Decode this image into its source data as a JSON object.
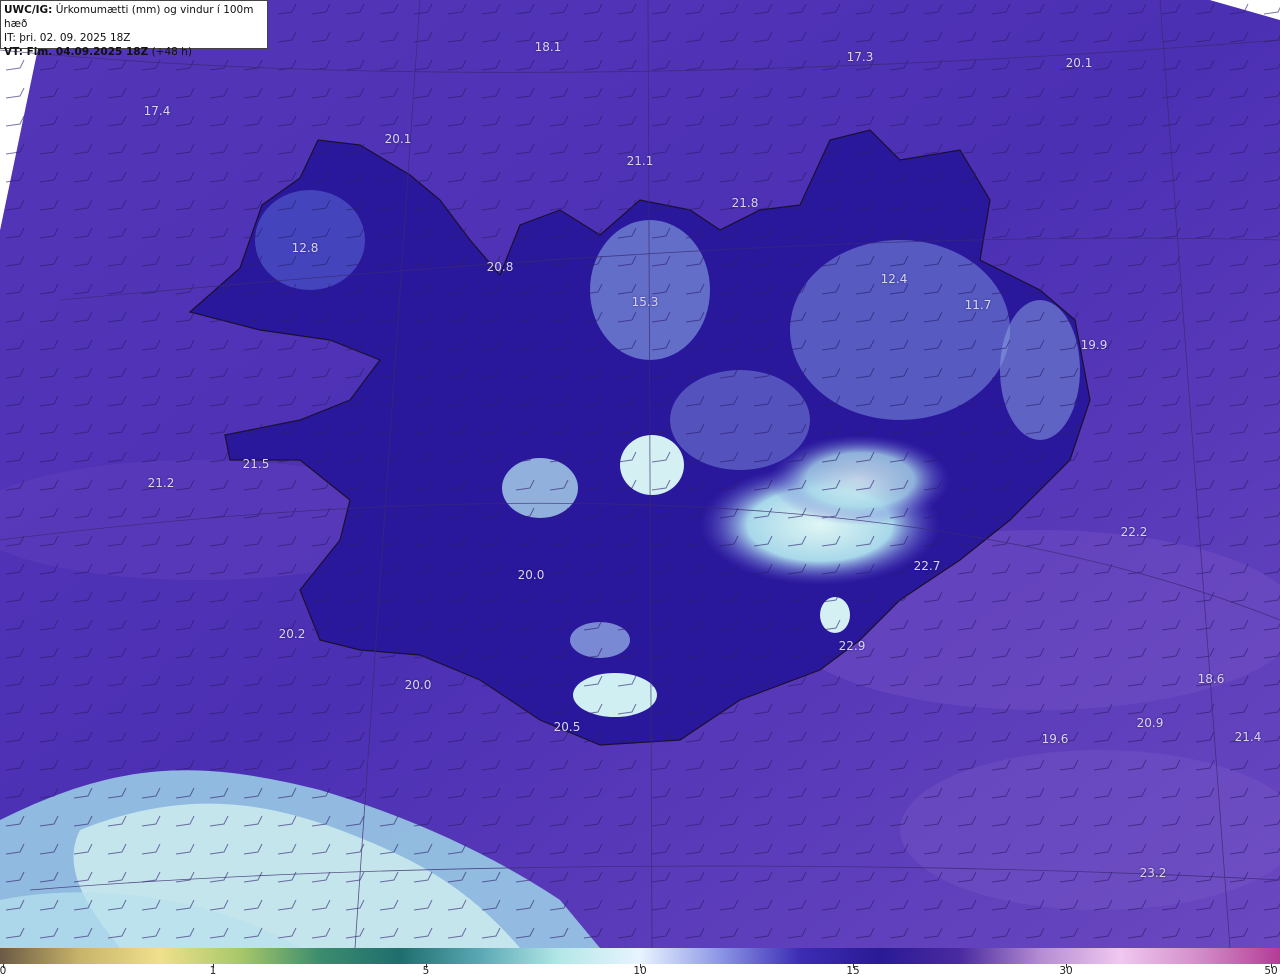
{
  "header": {
    "model": "UWC/IG:",
    "title": "Úrkomumætti (mm) og vindur í 100m hæð",
    "initial_time": "IT: þri. 02. 09. 2025 18Z",
    "valid_label": "VT: Fim. 04.09.2025 18Z",
    "valid_offset": "(+48 h)"
  },
  "labels": [
    {
      "text": "18.1"
    },
    {
      "text": "17.3"
    },
    {
      "text": "20.1"
    },
    {
      "text": "17.4"
    },
    {
      "text": "20.1"
    },
    {
      "text": "21.1"
    },
    {
      "text": "21.8"
    },
    {
      "text": "12.8"
    },
    {
      "text": "20.8"
    },
    {
      "text": "15.3"
    },
    {
      "text": "12.4"
    },
    {
      "text": "11.7"
    },
    {
      "text": "19.9"
    },
    {
      "text": "21.5"
    },
    {
      "text": "21.2"
    },
    {
      "text": "22.2"
    },
    {
      "text": "22.7"
    },
    {
      "text": "20.0"
    },
    {
      "text": "20.2"
    },
    {
      "text": "22.9"
    },
    {
      "text": "20.0"
    },
    {
      "text": "18.6"
    },
    {
      "text": "20.5"
    },
    {
      "text": "20.9"
    },
    {
      "text": "19.6"
    },
    {
      "text": "21.4"
    },
    {
      "text": "23.2"
    }
  ],
  "colorbar": {
    "ticks": [
      "0",
      "1",
      "5",
      "10",
      "15",
      "30",
      "50"
    ],
    "colors": [
      "#6b5a45",
      "#c8b46a",
      "#f0e08c",
      "#a8c86a",
      "#3c8c6e",
      "#1f6e6e",
      "#5aa8b4",
      "#b4e8e8",
      "#e8f4ff",
      "#8c96e6",
      "#3c2cb4",
      "#2a1a96",
      "#4a2aa0",
      "#b48cd2",
      "#f0c8f0",
      "#d28cc8",
      "#b43c96"
    ]
  },
  "map": {
    "sea_color": "#4f34b6",
    "land_color": "#2d1aa0",
    "highlight_color": "#cfeff2"
  }
}
